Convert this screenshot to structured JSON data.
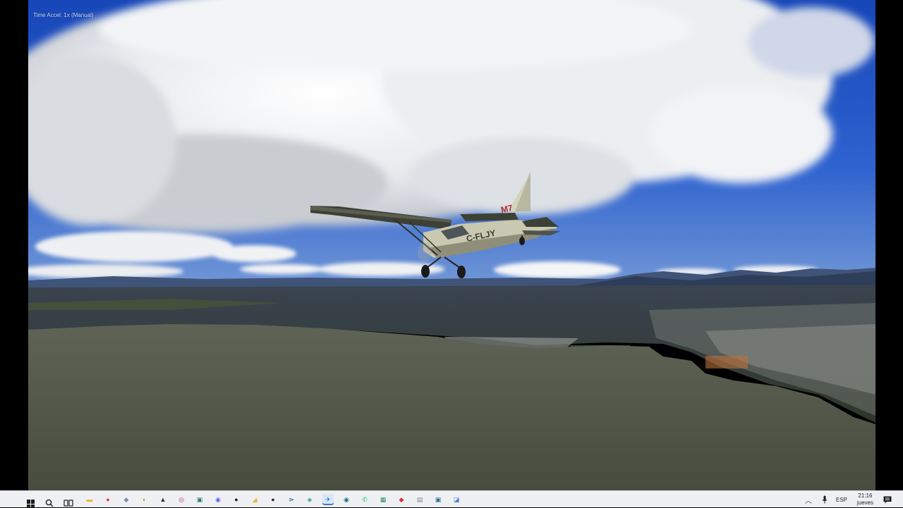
{
  "hud": {
    "time_accel": "Time Accel: 1x (Manual)"
  },
  "aircraft": {
    "registration": "C-FLJY",
    "tail_mark": "M7"
  },
  "taskbar": {
    "language": "ESP",
    "time": "21:16",
    "day": "jueves",
    "apps": [
      {
        "name": "file-explorer-icon",
        "color": "#e8b32e",
        "glyph": "▬"
      },
      {
        "name": "chrome-icon",
        "color": "#db4437",
        "glyph": "●"
      },
      {
        "name": "app-icon-3",
        "color": "#7b8ca3",
        "glyph": "◆"
      },
      {
        "name": "app-icon-4",
        "color": "#e07b1a",
        "glyph": "◐"
      },
      {
        "name": "app-icon-5",
        "color": "#2b2b2b",
        "glyph": "▲"
      },
      {
        "name": "instagram-icon",
        "color": "#c13584",
        "glyph": "◎"
      },
      {
        "name": "app-icon-7",
        "color": "#2e7d6b",
        "glyph": "▣"
      },
      {
        "name": "discord-icon",
        "color": "#5865f2",
        "glyph": "◉"
      },
      {
        "name": "app-icon-9",
        "color": "#1f1f1f",
        "glyph": "●"
      },
      {
        "name": "app-icon-10",
        "color": "#e8b32e",
        "glyph": "◢"
      },
      {
        "name": "app-icon-11",
        "color": "#333333",
        "glyph": "●"
      },
      {
        "name": "app-icon-12",
        "color": "#4a6fa5",
        "glyph": "⋗"
      },
      {
        "name": "app-icon-13",
        "color": "#2a9d8f",
        "glyph": "◈"
      },
      {
        "name": "msfs-icon",
        "color": "#1976d2",
        "glyph": "✈",
        "active": true
      },
      {
        "name": "app-icon-15",
        "color": "#1d6f8a",
        "glyph": "◉"
      },
      {
        "name": "whatsapp-icon",
        "color": "#25d366",
        "glyph": "✆"
      },
      {
        "name": "app-icon-17",
        "color": "#2f8f5b",
        "glyph": "▦"
      },
      {
        "name": "app-icon-18",
        "color": "#d32f2f",
        "glyph": "◆"
      },
      {
        "name": "app-icon-19",
        "color": "#7a8794",
        "glyph": "▤"
      },
      {
        "name": "app-icon-20",
        "color": "#2e6f8e",
        "glyph": "▣"
      },
      {
        "name": "app-icon-21",
        "color": "#4b7bd4",
        "glyph": "◪"
      }
    ]
  }
}
